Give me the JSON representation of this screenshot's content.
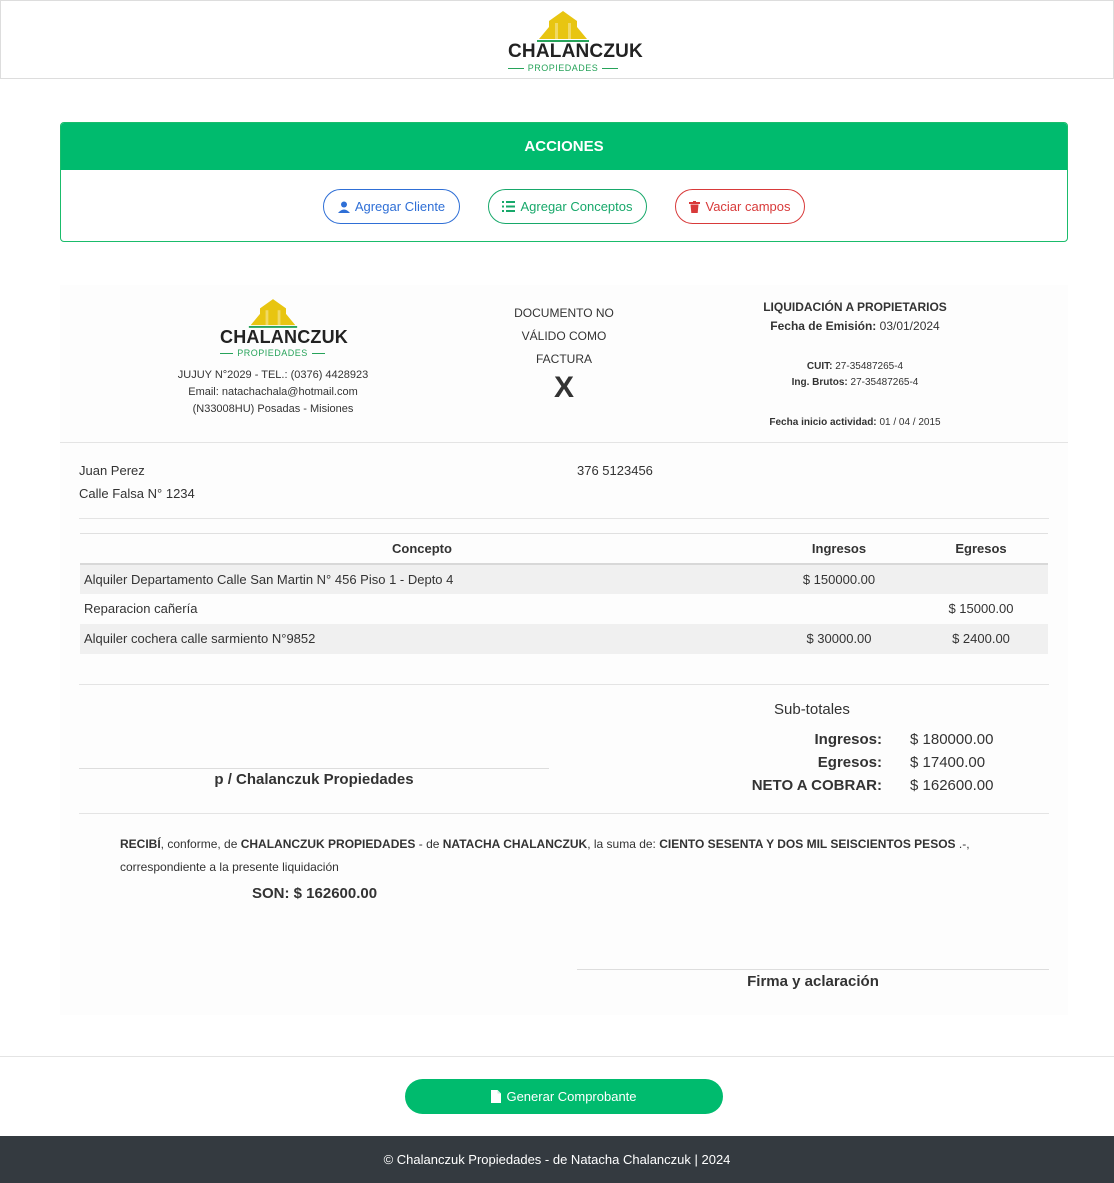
{
  "logo": {
    "brand": "CHALANCZUK",
    "sub": "PROPIEDADES"
  },
  "acciones": {
    "title": "ACCIONES",
    "buttons": {
      "agregar_cliente": "Agregar Cliente",
      "agregar_conceptos": "Agregar Conceptos",
      "vaciar_campos": "Vaciar campos"
    }
  },
  "company": {
    "address": "JUJUY N°2029 - TEL.: (0376) 4428923",
    "email": "Email: natachachala@hotmail.com",
    "city": "(N33008HU) Posadas - Misiones"
  },
  "document_note": {
    "line1": "DOCUMENTO NO",
    "line2": "VÁLIDO COMO",
    "line3": "FACTURA",
    "letter": "X"
  },
  "liquidacion": {
    "title": "LIQUIDACIÓN A PROPIETARIOS",
    "fecha_label": "Fecha de Emisión:",
    "fecha_value": "03/01/2024",
    "cuit_label": "CUIT:",
    "cuit_value": "27-35487265-4",
    "ib_label": "Ing. Brutos:",
    "ib_value": "27-35487265-4",
    "inicio_label": "Fecha inicio actividad:",
    "inicio_value": "01 / 04 / 2015"
  },
  "client": {
    "name": "Juan Perez",
    "address": "Calle Falsa N° 1234",
    "phone": "376 5123456"
  },
  "table": {
    "headers": {
      "concepto": "Concepto",
      "ingresos": "Ingresos",
      "egresos": "Egresos"
    },
    "rows": [
      {
        "concepto": "Alquiler Departamento Calle San Martin N° 456 Piso 1 - Depto 4",
        "ingresos": "$ 150000.00",
        "egresos": ""
      },
      {
        "concepto": "Reparacion cañería",
        "ingresos": "",
        "egresos": "$ 15000.00"
      },
      {
        "concepto": "Alquiler cochera calle sarmiento N°9852",
        "ingresos": "$ 30000.00",
        "egresos": "$ 2400.00"
      }
    ]
  },
  "subtotales": {
    "title": "Sub-totales",
    "ingresos_label": "Ingresos:",
    "ingresos_value": "$ 180000.00",
    "egresos_label": "Egresos:",
    "egresos_value": "$ 17400.00",
    "neto_label": "NETO A COBRAR:",
    "neto_value": "$ 162600.00"
  },
  "firma_empresa": "p / Chalanczuk Propiedades",
  "recibo": {
    "recibi": "RECIBÍ",
    "t1": ", conforme, de ",
    "empresa": "CHALANCZUK PROPIEDADES",
    "t2": " - de ",
    "persona": "NATACHA CHALANCZUK",
    "t3": ", la suma de: ",
    "monto_letras": "CIENTO SESENTA Y DOS MIL SEISCIENTOS PESOS",
    "t4": " .-,",
    "line2": "correspondiente a la presente liquidación",
    "son": "SON: $ 162600.00"
  },
  "firma_aclaracion": "Firma y aclaración",
  "generar": "Generar Comprobante",
  "footer": "© Chalanczuk Propiedades - de Natacha Chalanczuk | 2024",
  "colors": {
    "primary_green": "#00bb6e",
    "blue": "#2f6fd6",
    "red": "#d83a3a",
    "logo_yellow": "#e8c511",
    "footer_dark": "#343a40"
  }
}
